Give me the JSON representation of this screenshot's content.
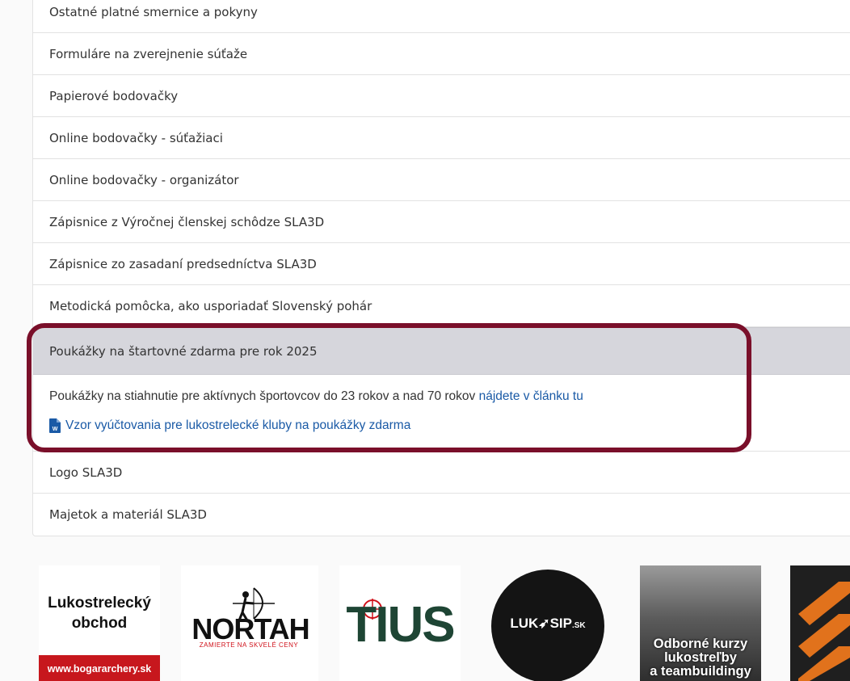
{
  "accordion": {
    "items_before": [
      "Ostatné platné smernice a pokyny",
      "Formuláre na zverejnenie súťaže",
      "Papierové bodovačky",
      "Online bodovačky - súťažiaci",
      "Online bodovačky - organizátor",
      "Zápisnice z Výročnej členskej schôdze SLA3D",
      "Zápisnice zo zasadaní predsedníctva SLA3D",
      "Metodická pomôcka, ako usporiadať Slovenský pohár"
    ],
    "active_item": {
      "title": "Poukážky na štartovné zdarma pre rok 2025",
      "body_text": "Poukážky na stiahnutie pre aktívnych športovcov do 23 rokov a nad 70 rokov ",
      "body_link": "nájdete v článku tu",
      "doc_link": "Vzor vyúčtovania pre lukostrelecké kluby na poukážky zdarma"
    },
    "items_after": [
      "Logo SLA3D",
      "Majetok a materiál SLA3D"
    ]
  },
  "highlight_color": "#7a0f2a",
  "link_color": "#1a5aa6",
  "sponsors": {
    "bogar": {
      "line1": "Lukostrelecký",
      "line2": "obchod",
      "url_text": "www.bogararchery.sk"
    },
    "nortah": {
      "name": "NORTAH",
      "tagline": "ZAMIERTE NA SKVELÉ CENY"
    },
    "tius": {
      "name": "TIUS"
    },
    "lukasip": {
      "name": "LUK",
      "name2": "SIP",
      "suffix": ".SK"
    },
    "kurzy": {
      "line1": "Odborné kurzy",
      "line2": "lukostreľby",
      "line3": "a teambuildingy"
    }
  }
}
